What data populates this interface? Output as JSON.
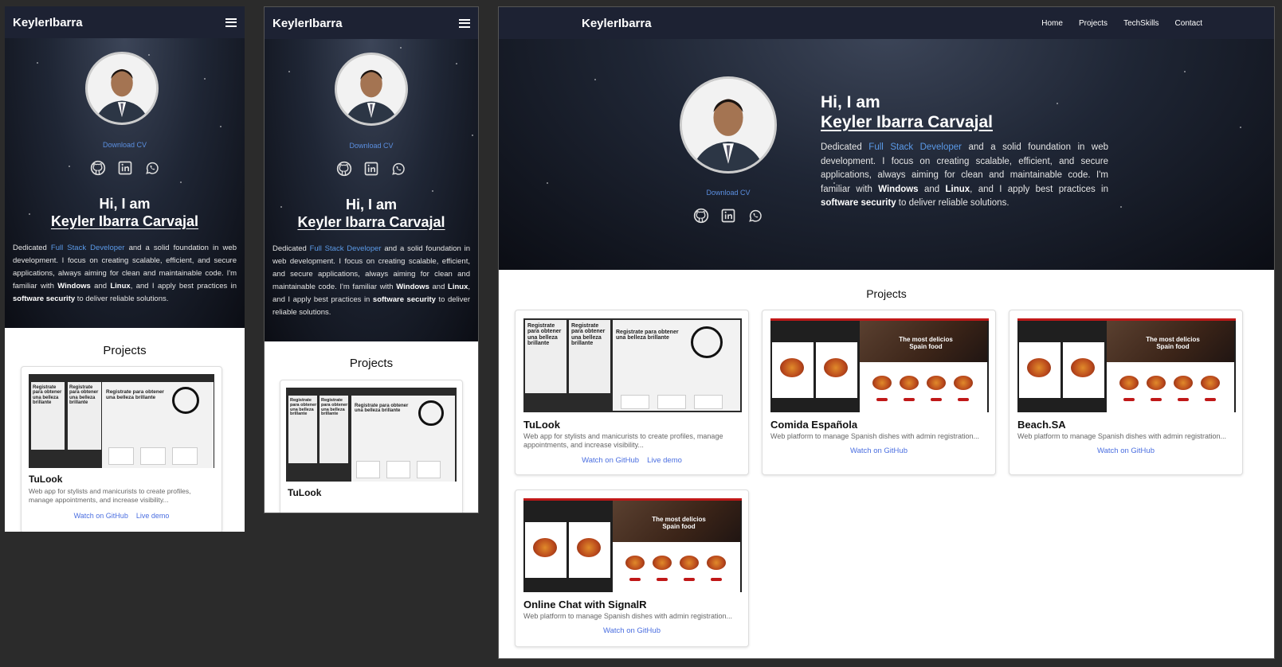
{
  "brand": "KeylerIbarra",
  "nav": {
    "home": "Home",
    "projects": "Projects",
    "techskills": "TechSkills",
    "contact": "Contact"
  },
  "hero": {
    "download_cv": "Download CV",
    "greeting": "Hi, I am",
    "name": "Keyler Ibarra Carvajal",
    "bio": {
      "p1": "Dedicated ",
      "role": "Full Stack Developer",
      "p2": " and a solid foundation in web development. I focus on creating scalable, efficient, and secure applications, always aiming for clean and maintainable code. I'm familiar with ",
      "os1": "Windows",
      "p3": " and ",
      "os2": "Linux",
      "p4": ", and I apply best practices in ",
      "sec": "software security",
      "p5": " to deliver reliable solutions."
    }
  },
  "projects": {
    "title": "Projects",
    "items": [
      {
        "title": "TuLook",
        "desc": "Web app for stylists and manicurists to create profiles, manage appointments, and increase visibility...",
        "github": "Watch on GitHub",
        "demo": "Live demo"
      },
      {
        "title": "Comida Española",
        "desc": "Web platform to manage Spanish dishes with admin registration...",
        "github": "Watch on GitHub"
      },
      {
        "title": "Beach.SA",
        "desc": "Web platform to manage Spanish dishes with admin registration...",
        "github": "Watch on GitHub"
      },
      {
        "title": "Online Chat with SignalR",
        "desc": "Web platform to manage Spanish dishes with admin registration...",
        "github": "Watch on GitHub"
      }
    ]
  },
  "thumbs": {
    "tulook_headline": "Registrate para obtener una belleza brillante",
    "tulook_short": "Registrate para obtener una belleza brillante",
    "food_headline": "The most delicios Spain food"
  },
  "colors": {
    "nav_bg": "#1d2233",
    "accent": "#5b9ae8",
    "link": "#4a6ee0",
    "food_red": "#c01818"
  }
}
